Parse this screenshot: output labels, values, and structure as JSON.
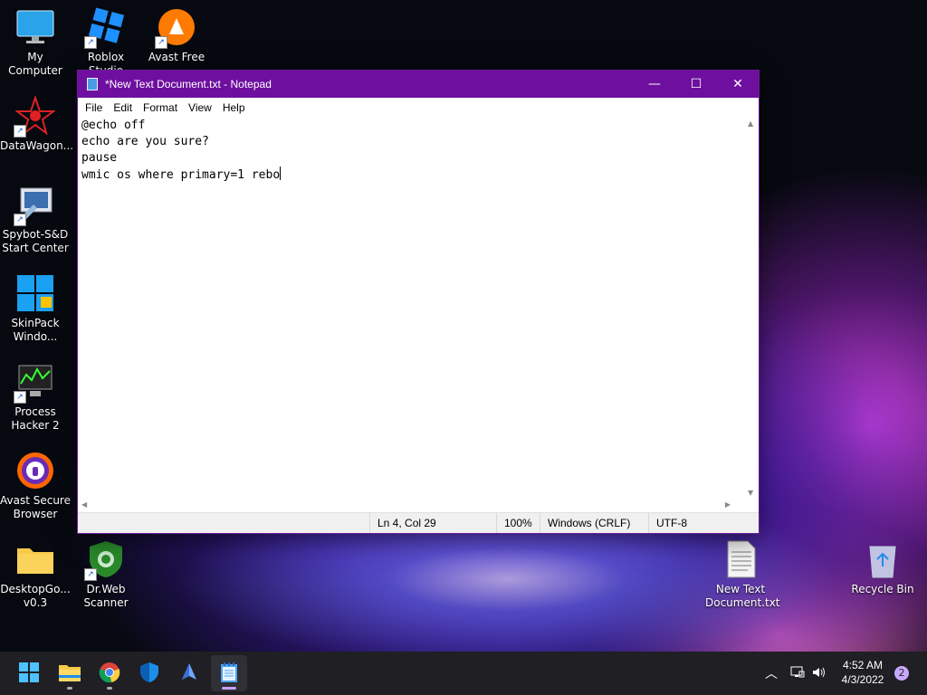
{
  "desktop": {
    "icons": [
      {
        "label": "My Computer",
        "icon": "monitor-icon"
      },
      {
        "label": "Roblox Studio",
        "icon": "roblox-studio-icon"
      },
      {
        "label": "Avast Free",
        "icon": "avast-icon"
      },
      {
        "label": "DataWagon...",
        "icon": "datawagon-icon"
      },
      {
        "label": "Spybot-S&D Start Center",
        "icon": "spybot-icon"
      },
      {
        "label": "SkinPack Windo...",
        "icon": "skinpack-icon"
      },
      {
        "label": "Process Hacker 2",
        "icon": "process-hacker-icon"
      },
      {
        "label": "Avast Secure Browser",
        "icon": "avast-browser-icon"
      },
      {
        "label": "DesktopGo... v0.3",
        "icon": "folder-icon"
      },
      {
        "label": "Dr.Web Scanner",
        "icon": "drweb-icon"
      },
      {
        "label": "New Text Document.txt",
        "icon": "text-file-icon"
      },
      {
        "label": "Recycle Bin",
        "icon": "recycle-bin-icon"
      }
    ]
  },
  "notepad": {
    "title": "*New Text Document.txt - Notepad",
    "menu": [
      "File",
      "Edit",
      "Format",
      "View",
      "Help"
    ],
    "lines": [
      "@echo off",
      "echo are you sure?",
      "pause",
      "wmic os where primary=1 rebo"
    ],
    "status": {
      "position": "Ln 4, Col 29",
      "zoom": "100%",
      "line_endings": "Windows (CRLF)",
      "encoding": "UTF-8"
    },
    "controls": {
      "minimize": "—",
      "maximize": "☐",
      "close": "✕"
    }
  },
  "taskbar": {
    "apps": [
      "start-icon",
      "file-explorer-icon",
      "chrome-icon",
      "defender-icon",
      "app-icon",
      "notepad-icon"
    ],
    "clock": {
      "time": "4:52 AM",
      "date": "4/3/2022"
    },
    "notifications": "2"
  }
}
